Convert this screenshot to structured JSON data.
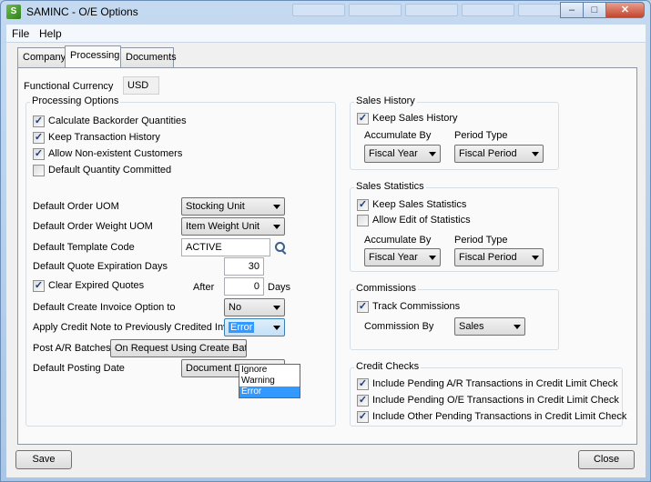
{
  "window": {
    "title": "SAMINC - O/E Options",
    "icon_letter": "S",
    "controls": {
      "minimize": "–",
      "maximize": "□",
      "close": "✕"
    }
  },
  "menu": {
    "file": "File",
    "help": "Help"
  },
  "tabs": [
    {
      "label": "Company"
    },
    {
      "label": "Processing"
    },
    {
      "label": "Documents"
    }
  ],
  "functional_currency": {
    "label": "Functional Currency",
    "value": "USD"
  },
  "processing_options": {
    "title": "Processing Options",
    "checkboxes": [
      {
        "label": "Calculate Backorder Quantities",
        "checked": true
      },
      {
        "label": "Keep Transaction History",
        "checked": true
      },
      {
        "label": "Allow Non-existent Customers",
        "checked": true
      },
      {
        "label": "Default Quantity Committed",
        "checked": false
      }
    ],
    "default_order_uom": {
      "label": "Default Order UOM",
      "value": "Stocking Unit"
    },
    "default_order_weight_uom": {
      "label": "Default Order Weight UOM",
      "value": "Item Weight Unit"
    },
    "default_template_code": {
      "label": "Default Template Code",
      "value": "ACTIVE"
    },
    "default_quote_expiration_days": {
      "label": "Default Quote Expiration Days",
      "value": "30"
    },
    "clear_expired_quotes": {
      "label": "Clear Expired Quotes",
      "checked": true,
      "after_label": "After",
      "value": "0",
      "days_label": "Days"
    },
    "default_create_invoice_option": {
      "label": "Default Create Invoice Option to",
      "value": "No"
    },
    "apply_credit_note": {
      "label": "Apply Credit Note to Previously Credited Invoice",
      "value": "Error",
      "options": [
        "Ignore",
        "Warning",
        "Error"
      ]
    },
    "post_ar_batches": {
      "label": "Post A/R Batches",
      "value": "On Request Using Create Batch"
    },
    "default_posting_date": {
      "label": "Default Posting Date",
      "value": "Document Date"
    }
  },
  "sales_history": {
    "title": "Sales History",
    "keep": {
      "label": "Keep Sales History",
      "checked": true
    },
    "accumulate_by": {
      "label": "Accumulate By",
      "value": "Fiscal Year"
    },
    "period_type": {
      "label": "Period Type",
      "value": "Fiscal Period"
    }
  },
  "sales_statistics": {
    "title": "Sales Statistics",
    "keep": {
      "label": "Keep Sales Statistics",
      "checked": true
    },
    "allow_edit": {
      "label": "Allow Edit of Statistics",
      "checked": false
    },
    "accumulate_by": {
      "label": "Accumulate By",
      "value": "Fiscal Year"
    },
    "period_type": {
      "label": "Period Type",
      "value": "Fiscal Period"
    }
  },
  "commissions": {
    "title": "Commissions",
    "track": {
      "label": "Track Commissions",
      "checked": true
    },
    "commission_by": {
      "label": "Commission By",
      "value": "Sales"
    }
  },
  "credit_checks": {
    "title": "Credit Checks",
    "items": [
      {
        "label": "Include Pending A/R Transactions in Credit Limit Check",
        "checked": true
      },
      {
        "label": "Include Pending O/E Transactions in Credit Limit Check",
        "checked": true
      },
      {
        "label": "Include Other Pending Transactions in Credit Limit Check",
        "checked": true
      }
    ]
  },
  "buttons": {
    "save": "Save",
    "close": "Close"
  },
  "check_glyph": "✓"
}
